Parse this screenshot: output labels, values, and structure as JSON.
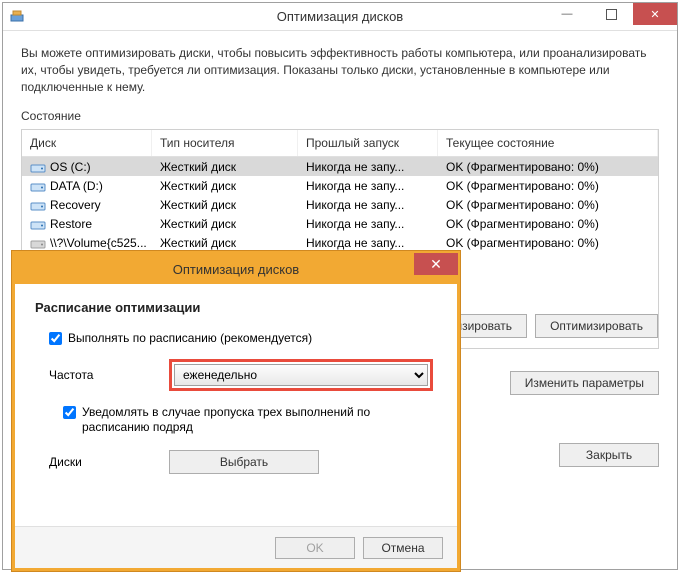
{
  "window": {
    "title": "Оптимизация дисков",
    "intro": "Вы можете оптимизировать диски, чтобы повысить эффективность работы  компьютера, или проанализировать их, чтобы увидеть, требуется ли оптимизация. Показаны только диски, установленные в компьютере или подключенные к нему.",
    "state_label": "Состояние"
  },
  "table": {
    "headers": {
      "disk": "Диск",
      "type": "Тип носителя",
      "last": "Прошлый запуск",
      "state": "Текущее состояние"
    },
    "rows": [
      {
        "icon": "hdd",
        "name": "OS (C:)",
        "type": "Жесткий диск",
        "last": "Никогда не запу...",
        "state": "OK (Фрагментировано: 0%)",
        "selected": true
      },
      {
        "icon": "hdd",
        "name": "DATA (D:)",
        "type": "Жесткий диск",
        "last": "Никогда не запу...",
        "state": "OK (Фрагментировано: 0%)",
        "selected": false
      },
      {
        "icon": "hdd",
        "name": "Recovery",
        "type": "Жесткий диск",
        "last": "Никогда не запу...",
        "state": "OK (Фрагментировано: 0%)",
        "selected": false
      },
      {
        "icon": "hdd",
        "name": "Restore",
        "type": "Жесткий диск",
        "last": "Никогда не запу...",
        "state": "OK (Фрагментировано: 0%)",
        "selected": false
      },
      {
        "icon": "hdd-dim",
        "name": "\\\\?\\Volume{c525...",
        "type": "Жесткий диск",
        "last": "Никогда не запу...",
        "state": "OK (Фрагментировано: 0%)",
        "selected": false
      }
    ]
  },
  "buttons": {
    "analyze": "Анализировать",
    "optimize": "Оптимизировать",
    "change": "Изменить параметры",
    "close": "Закрыть",
    "ok": "OK",
    "cancel": "Отмена",
    "choose": "Выбрать"
  },
  "dialog": {
    "title": "Оптимизация дисков",
    "heading": "Расписание оптимизации",
    "schedule_checkbox": "Выполнять по расписанию (рекомендуется)",
    "frequency_label": "Частота",
    "frequency_value": "еженедельно",
    "notify_checkbox": "Уведомлять в случае пропуска трех выполнений по расписанию подряд",
    "disks_label": "Диски"
  }
}
